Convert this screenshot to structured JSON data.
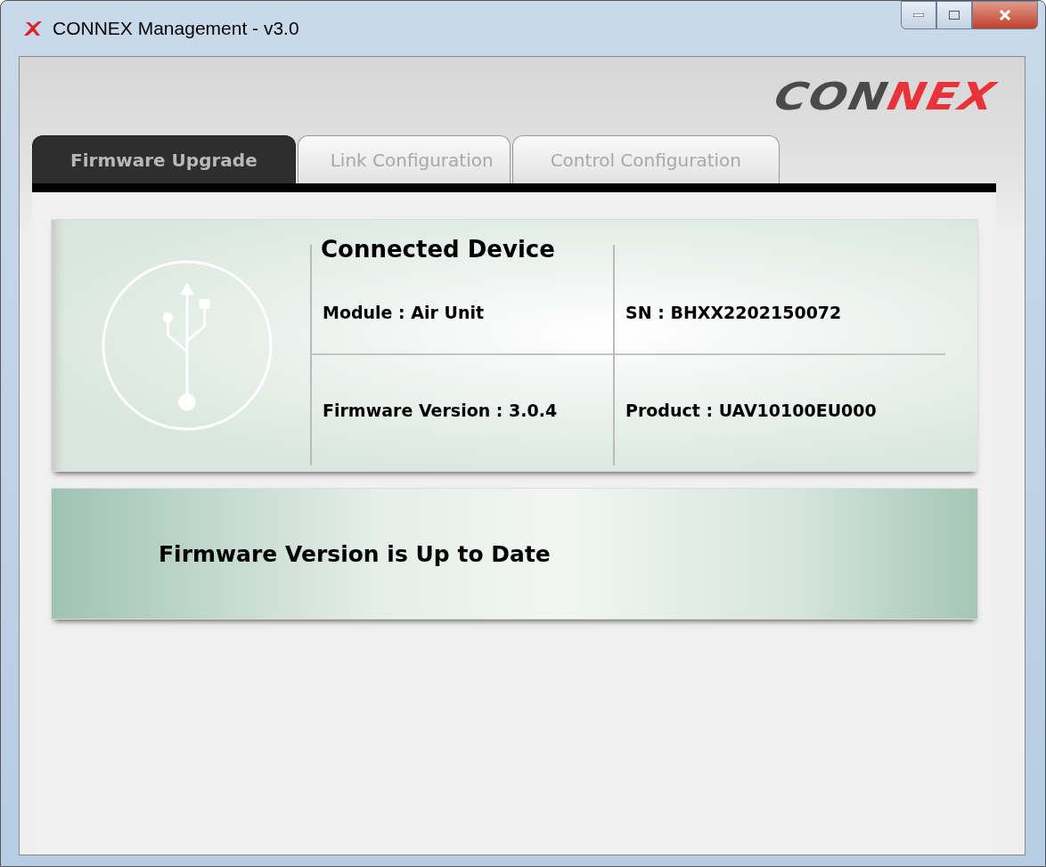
{
  "window": {
    "title": "CONNEX Management - v3.0"
  },
  "logo": [
    {
      "text": "CON",
      "color": "#4a4a4a"
    },
    {
      "text": "NEX",
      "color": "#e8333a"
    }
  ],
  "tabs": [
    {
      "label": "Firmware Upgrade",
      "selected": true
    },
    {
      "label": "Link Configuration",
      "selected": false
    },
    {
      "label": "Control Configuration",
      "selected": false
    }
  ],
  "device": {
    "title": "Connected Device",
    "fields": [
      "Module : Air Unit",
      "SN : BHXX2202150072",
      "Firmware Version : 3.0.4",
      "Product : UAV10100EU000"
    ]
  },
  "status": {
    "message": "Firmware Version is Up to Date"
  }
}
